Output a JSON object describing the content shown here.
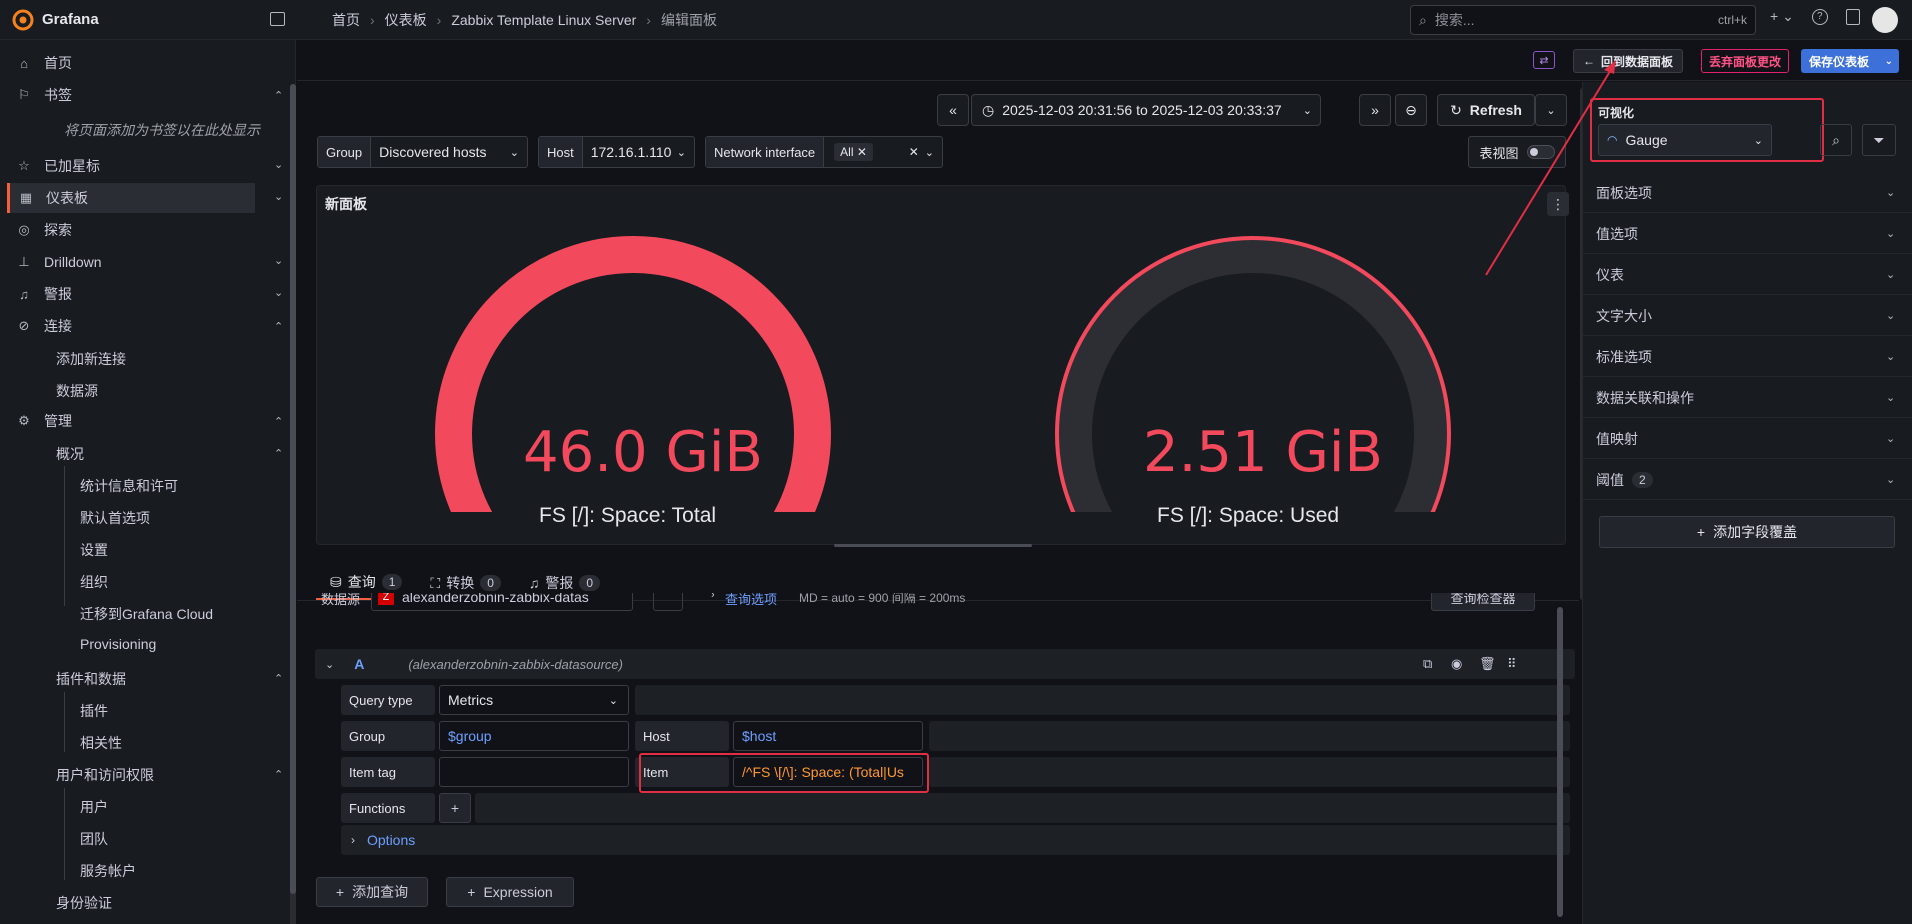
{
  "app": {
    "name": "Grafana"
  },
  "breadcrumbs": [
    "首页",
    "仪表板",
    "Zabbix Template Linux Server",
    "编辑面板"
  ],
  "search": {
    "placeholder": "搜索...",
    "shortcut": "ctrl+k"
  },
  "sidebar": {
    "home": "首页",
    "bookmarks": "书签",
    "bookmarks_hint": "将页面添加为书签以在此处显示",
    "starred": "已加星标",
    "dashboards": "仪表板",
    "explore": "探索",
    "drilldown": "Drilldown",
    "alerting": "警报",
    "connections": "连接",
    "add_connection": "添加新连接",
    "datasources": "数据源",
    "admin": "管理",
    "overview": "概况",
    "stats": "统计信息和许可",
    "default_prefs": "默认首选项",
    "settings": "设置",
    "orgs": "组织",
    "migrate": "迁移到Grafana Cloud",
    "provisioning": "Provisioning",
    "plugins_data": "插件和数据",
    "plugins": "插件",
    "correlations": "相关性",
    "users_access": "用户和访问权限",
    "users": "用户",
    "teams": "团队",
    "service_accounts": "服务帐户",
    "auth": "身份验证"
  },
  "actions": {
    "back": "回到数据面板",
    "discard": "丢弃面板更改",
    "save": "保存仪表板"
  },
  "timepicker": {
    "range": "2025-12-03 20:31:56 to 2025-12-03 20:33:37",
    "refresh": "Refresh"
  },
  "variables": {
    "group_label": "Group",
    "group_value": "Discovered hosts",
    "host_label": "Host",
    "host_value": "172.16.1.110",
    "iface_label": "Network interface",
    "iface_value": "All",
    "table_view": "表视图"
  },
  "panel": {
    "title": "新面板",
    "gauges": [
      {
        "value": "46.0 GiB",
        "label": "FS [/]: Space: Total",
        "fill": 1.0
      },
      {
        "value": "2.51 GiB",
        "label": "FS [/]: Space: Used",
        "fill": 0.055
      }
    ],
    "color": "#f2495c"
  },
  "tabs": {
    "query": "查询",
    "query_count": "1",
    "transform": "转换",
    "transform_count": "0",
    "alert": "警报",
    "alert_count": "0"
  },
  "query": {
    "datasource_label": "数据源",
    "datasource": "alexanderzobnin-zabbix-datas",
    "options_link": "查询选项",
    "options_text": "MD = auto = 900   间隔 = 200ms",
    "inspector": "查询检查器",
    "ref": "A",
    "ref_source": "(alexanderzobnin-zabbix-datasource)",
    "query_type_label": "Query type",
    "query_type": "Metrics",
    "group_label": "Group",
    "group": "$group",
    "host_label": "Host",
    "host": "$host",
    "item_tag_label": "Item tag",
    "item_tag": "",
    "item_label": "Item",
    "item": "/^FS \\[/\\]: Space: (Total|Us",
    "functions_label": "Functions",
    "options": "Options",
    "add_query": "添加查询",
    "expression": "Expression"
  },
  "right_pane": {
    "viz_label": "可视化",
    "viz": "Gauge",
    "sections": [
      "面板选项",
      "值选项",
      "仪表",
      "文字大小",
      "标准选项",
      "数据关联和操作",
      "值映射"
    ],
    "thresholds": "阈值",
    "thresholds_count": "2",
    "add_override": "添加字段覆盖"
  }
}
